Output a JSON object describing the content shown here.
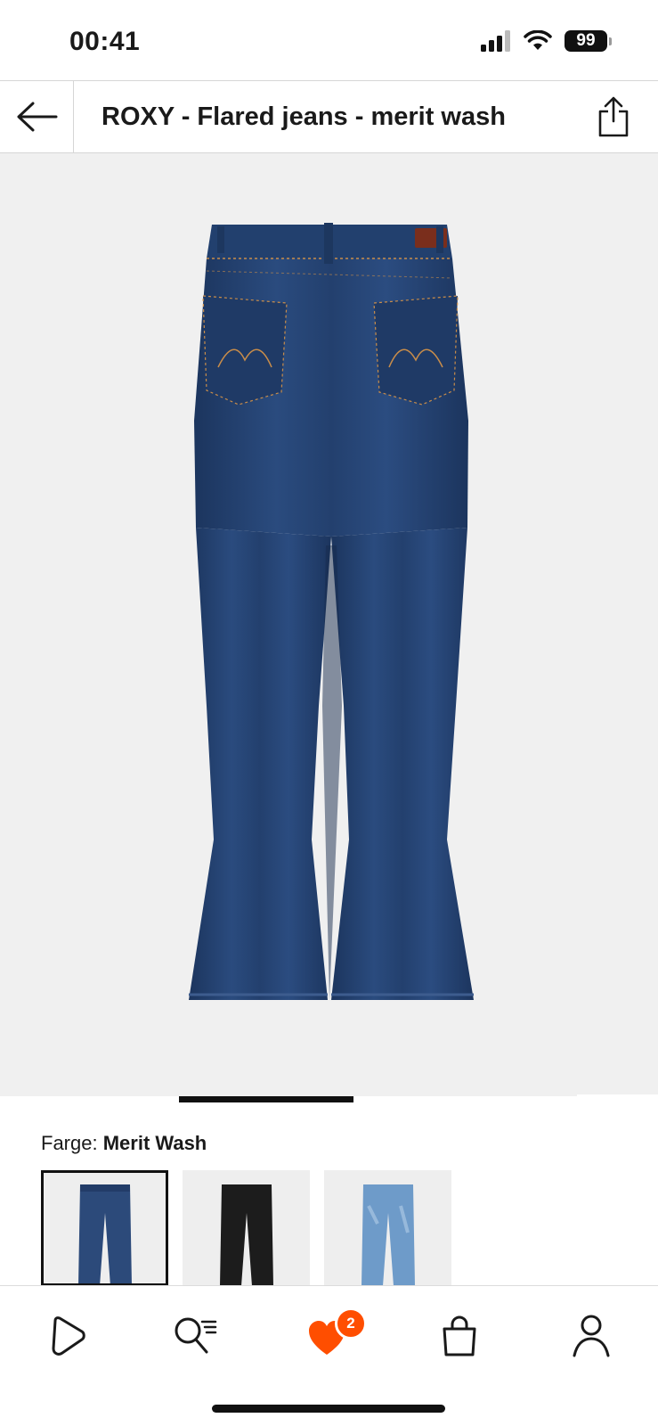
{
  "status_bar": {
    "time": "00:41",
    "battery": "99"
  },
  "header": {
    "title": "ROXY - Flared jeans - merit wash"
  },
  "gallery": {
    "progress": 0.49
  },
  "color": {
    "label": "Farge:",
    "value": "Merit Wash"
  },
  "swatches": [
    {
      "name": "merit-wash",
      "color": "#2c4a7a",
      "selected": true
    },
    {
      "name": "black",
      "color": "#1c1c1c",
      "selected": false
    },
    {
      "name": "light-blue",
      "color": "#6e9bc9",
      "selected": false
    }
  ],
  "bottom_nav": {
    "items": [
      {
        "icon": "home-icon"
      },
      {
        "icon": "search-icon"
      },
      {
        "icon": "wishlist-hearts-icon",
        "badge": "2"
      },
      {
        "icon": "bag-icon"
      },
      {
        "icon": "profile-icon"
      }
    ]
  },
  "colors": {
    "accent": "#ff4e00",
    "denim": "#22406f"
  }
}
